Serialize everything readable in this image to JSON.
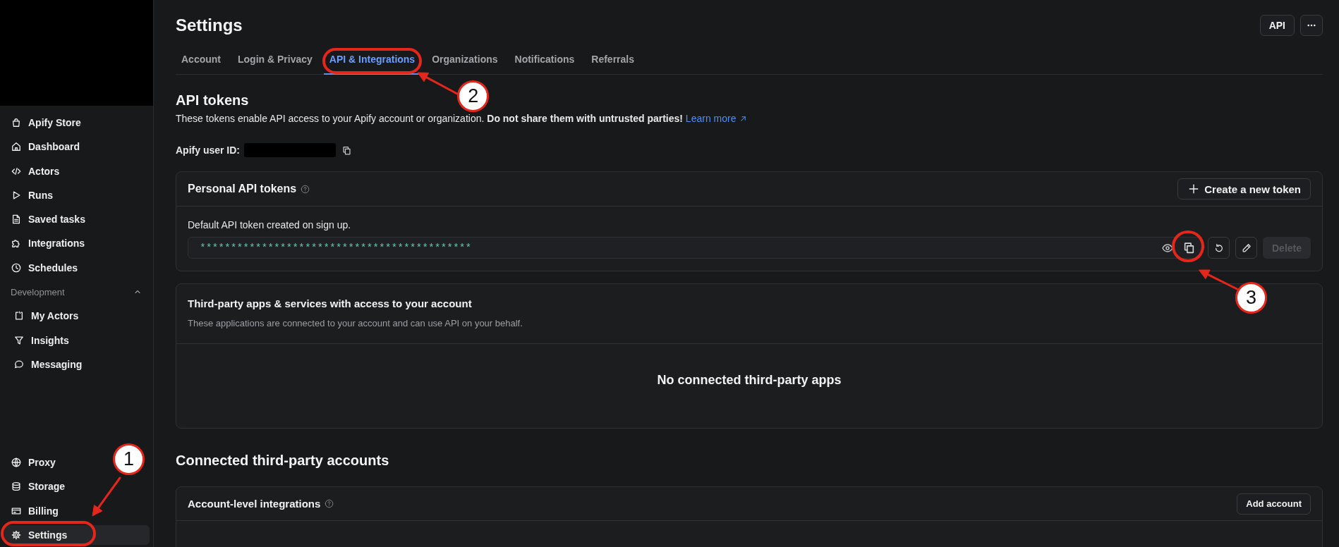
{
  "sidebar": {
    "items": [
      {
        "label": "Apify Store",
        "selected": false
      },
      {
        "label": "Dashboard",
        "selected": false
      },
      {
        "label": "Actors",
        "selected": false
      },
      {
        "label": "Runs",
        "selected": false
      },
      {
        "label": "Saved tasks",
        "selected": false
      },
      {
        "label": "Integrations",
        "selected": false
      },
      {
        "label": "Schedules",
        "selected": false
      }
    ],
    "section": {
      "label": "Development",
      "expanded": true,
      "items": [
        {
          "label": "My Actors",
          "selected": false
        },
        {
          "label": "Insights",
          "selected": false
        },
        {
          "label": "Messaging",
          "selected": false
        }
      ]
    },
    "bottom_items": [
      {
        "label": "Proxy",
        "selected": false
      },
      {
        "label": "Storage",
        "selected": false
      },
      {
        "label": "Billing",
        "selected": false
      },
      {
        "label": "Settings",
        "selected": true,
        "callout": "1"
      }
    ]
  },
  "header": {
    "title": "Settings",
    "api_button": "API"
  },
  "tabs": [
    {
      "label": "Account",
      "selected": false
    },
    {
      "label": "Login & Privacy",
      "selected": false
    },
    {
      "label": "API & Integrations",
      "selected": true,
      "callout": "2"
    },
    {
      "label": "Organizations",
      "selected": false
    },
    {
      "label": "Notifications",
      "selected": false
    },
    {
      "label": "Referrals",
      "selected": false
    }
  ],
  "api_tokens": {
    "heading": "API tokens",
    "description": "These tokens enable API access to your Apify account or organization. **Do not share them with untrusted parties!**",
    "learn_more": "Learn more",
    "user_id_label": "Apify user ID:"
  },
  "personal_tokens": {
    "title": "Personal API tokens",
    "create_button": "Create a new token",
    "tokens": [
      {
        "description": "Default API token created on sign up.",
        "value": "********************************************",
        "copy_callout": "3",
        "delete_button": "Delete",
        "delete_disabled": true
      }
    ]
  },
  "third_party_apps": {
    "title": "Third-party apps & services with access to your account",
    "subtitle": "These applications are connected to your account and can use API on your behalf.",
    "empty_message": "No connected third-party apps"
  },
  "connected_accounts": {
    "heading": "Connected third-party accounts",
    "panel_title": "Account-level integrations",
    "add_button": "Add account"
  }
}
